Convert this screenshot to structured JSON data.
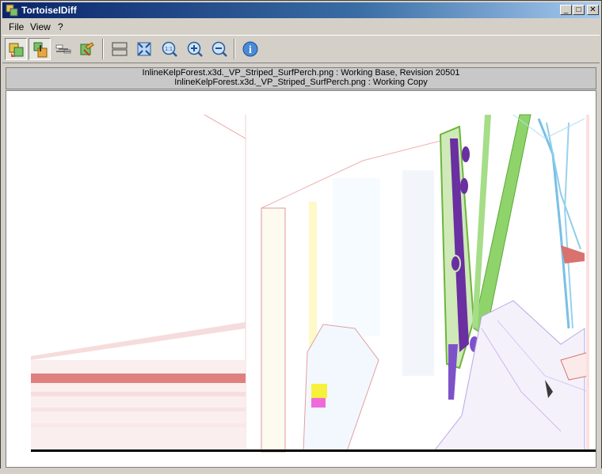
{
  "window": {
    "title": "TortoiseIDiff",
    "minimize_glyph": "_",
    "maximize_glyph": "□",
    "close_glyph": "✕"
  },
  "menu": {
    "items": [
      {
        "label": "File"
      },
      {
        "label": "View"
      },
      {
        "label": "?"
      }
    ]
  },
  "toolbar": {
    "buttons": [
      {
        "icon": "overlap-images-icon",
        "pressed": true
      },
      {
        "icon": "blend-alpha-icon",
        "pressed": true
      },
      {
        "icon": "link-images-icon",
        "pressed": false
      },
      {
        "icon": "fit-together-icon",
        "pressed": false
      },
      {
        "icon": "vertical-layout-icon",
        "pressed": false
      },
      {
        "icon": "fit-window-icon",
        "pressed": false
      },
      {
        "icon": "actual-size-icon",
        "pressed": false
      },
      {
        "icon": "zoom-in-icon",
        "pressed": false
      },
      {
        "icon": "zoom-out-icon",
        "pressed": false
      },
      {
        "icon": "info-icon",
        "pressed": false
      }
    ],
    "zoom_actual_glyph": "1:1",
    "info_glyph": "i"
  },
  "info": {
    "line1": "InlineKelpForest.x3d._VP_Striped_SurfPerch.png : Working Base, Revision 20501",
    "line2": "InlineKelpForest.x3d._VP_Striped_SurfPerch.png : Working Copy"
  },
  "colors": {
    "title_gradient_start": "#0a246a",
    "title_gradient_end": "#a6caf0",
    "face": "#d4d0c8",
    "diff_green": "#7fd35a",
    "diff_purple": "#6a2fa0",
    "diff_pink": "#d9726f",
    "diff_blue": "#79bfe6"
  }
}
